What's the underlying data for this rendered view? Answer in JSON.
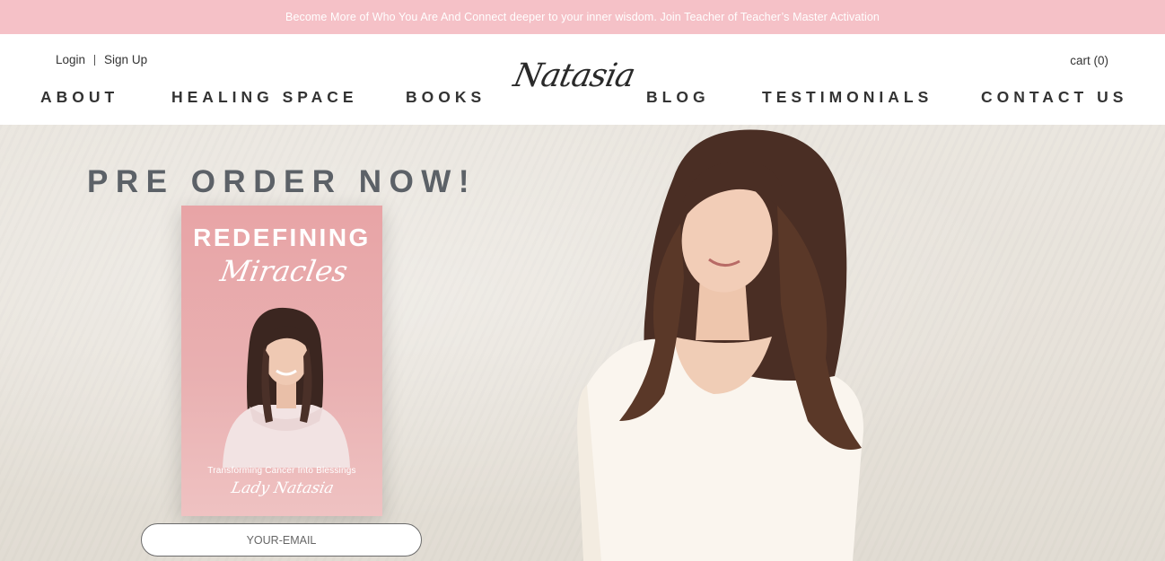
{
  "announcement": {
    "text": "Become More of Who You Are And Connect deeper to your inner wisdom. Join Teacher of Teacher’s Master Activation"
  },
  "header": {
    "login": "Login",
    "signup": "Sign Up",
    "cart": "cart (0)",
    "logo": "Natasia",
    "nav": {
      "about": "ABOUT",
      "healing": "HEALING SPACE",
      "books": "BOOKS",
      "blog": "BLOG",
      "testimonials": "TESTIMONIALS",
      "contact": "CONTACT US"
    }
  },
  "hero": {
    "headline": "PRE ORDER NOW!",
    "book": {
      "title": "REDEFINING",
      "subtitle": "Miracles",
      "tagline": "Transforming Cancer Into Blessings",
      "author": "Lady Natasia"
    },
    "email_placeholder": "YOUR-EMAIL"
  },
  "colors": {
    "announcement_bg": "#f5c1c7",
    "headline": "#5c6167",
    "book_pink": "#e8a4a6"
  }
}
